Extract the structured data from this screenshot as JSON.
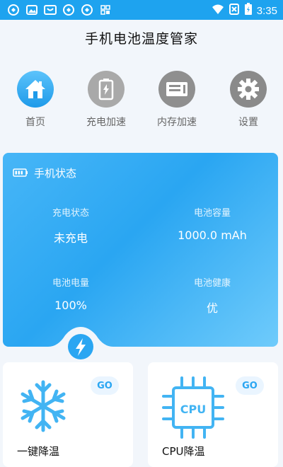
{
  "status_bar": {
    "time": "3:35",
    "left_icons": [
      "app-icon",
      "gallery-icon",
      "store-icon",
      "app-icon",
      "app-icon",
      "grid-icon"
    ],
    "right_icons": [
      "wifi-icon",
      "no-sim-icon",
      "battery-charging-icon"
    ]
  },
  "app": {
    "title": "手机电池温度管家"
  },
  "nav": {
    "items": [
      {
        "label": "首页",
        "icon": "home-icon",
        "active": true
      },
      {
        "label": "充电加速",
        "icon": "battery-icon",
        "active": false
      },
      {
        "label": "内存加速",
        "icon": "memory-icon",
        "active": false
      },
      {
        "label": "设置",
        "icon": "gear-icon",
        "active": false
      }
    ]
  },
  "status_card": {
    "title": "手机状态",
    "charging_state_label": "充电状态",
    "charging_state_value": "未充电",
    "capacity_label": "电池容量",
    "capacity_value": "1000.0 mAh",
    "level_label": "电池电量",
    "level_value": "100%",
    "health_label": "电池健康",
    "health_value": "优"
  },
  "features": [
    {
      "label": "一键降温",
      "badge": "GO",
      "icon": "snowflake-icon"
    },
    {
      "label": "CPU降温",
      "badge": "GO",
      "icon": "cpu-icon",
      "icon_text": "CPU"
    }
  ],
  "colors": {
    "accent": "#2aa6f2",
    "statusbar": "#1ea3ef",
    "inactive_icon": "#9a9a9a"
  }
}
